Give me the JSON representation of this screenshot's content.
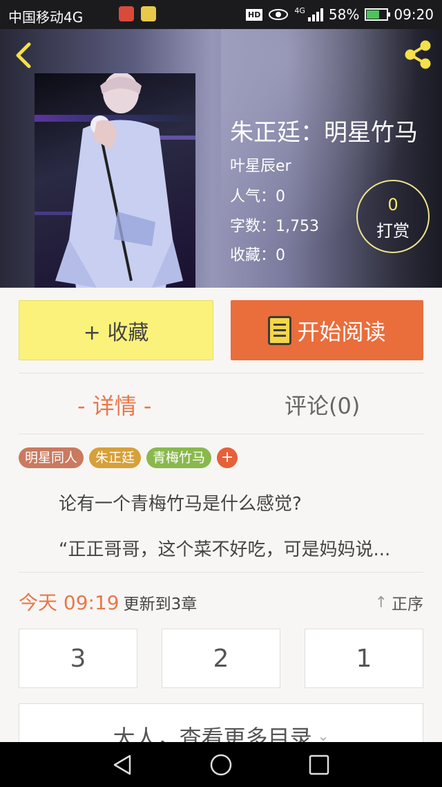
{
  "status_bar": {
    "carrier": "中国移动4G",
    "hd": "HD",
    "network": "4G",
    "battery": "58%",
    "time": "09:20"
  },
  "book": {
    "title": "朱正廷：明星竹马",
    "author": "叶星辰er",
    "popularity": "人气：0",
    "word_count": "字数：1,753",
    "favorites": "收藏：0",
    "reward_count": "0",
    "reward_label": "打赏"
  },
  "actions": {
    "favorite_label": "+ 收藏",
    "read_label": "开始阅读"
  },
  "tabs": {
    "detail": "- 详情 -",
    "comments": "评论(0)"
  },
  "tags": [
    {
      "label": "明星同人",
      "color": "#c97a60"
    },
    {
      "label": "朱正廷",
      "color": "#d6a03a"
    },
    {
      "label": "青梅竹马",
      "color": "#8ab84e"
    }
  ],
  "tag_add": "+",
  "summary": {
    "line1": "论有一个青梅竹马是什么感觉?",
    "line2": "“正正哥哥，这个菜不好吃，可是妈妈说..."
  },
  "update": {
    "time": "今天 09:19",
    "text": "更新到3章",
    "sort_label": "正序"
  },
  "chapters": [
    "3",
    "2",
    "1"
  ],
  "more_label": "大人，查看更多目录",
  "colors": {
    "accent_orange": "#ea6d3c",
    "fav_yellow": "#fbf27b",
    "reward_gold": "#f6ea6a"
  },
  "icons": {
    "back": "chevron-left-icon",
    "share": "share-icon",
    "book": "book-icon",
    "sort": "arrow-up-icon",
    "expand": "chevron-down-icon"
  }
}
